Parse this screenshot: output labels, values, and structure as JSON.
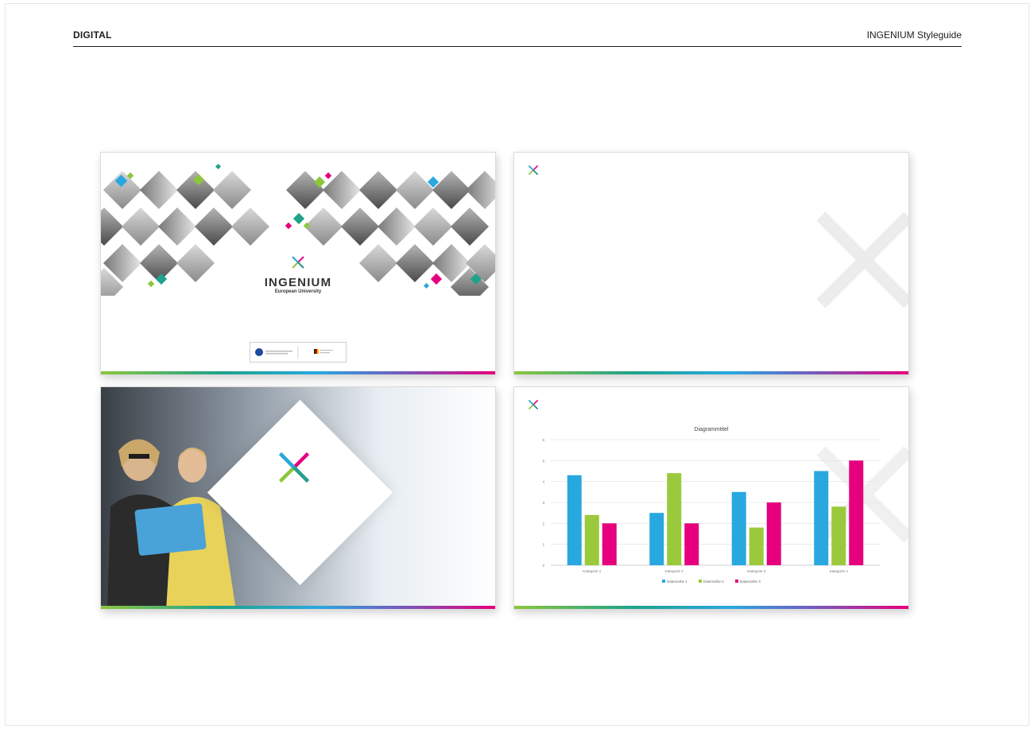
{
  "header": {
    "section": "DIGITAL",
    "title": "INGENIUM Styleguide"
  },
  "slide_title": {
    "logo_title": "INGENIUM",
    "logo_subtitle": "European University"
  },
  "colors": {
    "blue": "#29a8e0",
    "green": "#9bc93c",
    "magenta": "#e6007e",
    "teal": "#1fa38a"
  },
  "chart_data": {
    "type": "bar",
    "title": "Diagrammtitel",
    "categories": [
      "Kategorie 1",
      "Kategorie 2",
      "Kategorie 3",
      "Kategorie 4"
    ],
    "series": [
      {
        "name": "Datenreihe 1",
        "values": [
          4.3,
          2.5,
          3.5,
          4.5
        ]
      },
      {
        "name": "Datenreihe 2",
        "values": [
          2.4,
          4.4,
          1.8,
          2.8
        ]
      },
      {
        "name": "Datenreihe 3",
        "values": [
          2,
          2,
          3,
          5
        ]
      }
    ],
    "ylim": [
      0,
      6
    ],
    "yticks": [
      "0",
      "1",
      "2",
      "3",
      "4",
      "5",
      "6"
    ],
    "series_colors": [
      "#29a8e0",
      "#9bc93c",
      "#e6007e"
    ],
    "legend": "bottom",
    "grid": true
  }
}
